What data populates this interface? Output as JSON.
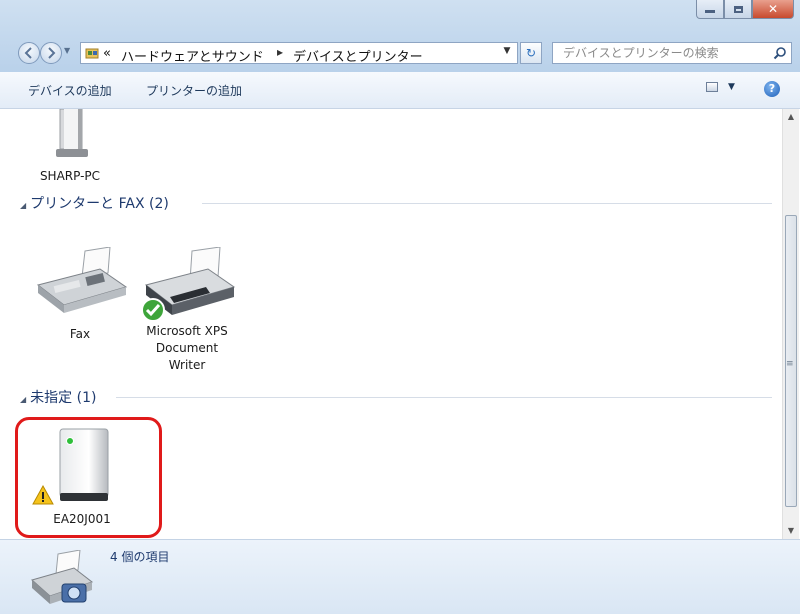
{
  "address": {
    "overflow": "«",
    "segments": [
      "ハードウェアとサウンド",
      "デバイスとプリンター"
    ]
  },
  "search": {
    "placeholder": "デバイスとプリンターの検索"
  },
  "toolbar": {
    "add_device": "デバイスの追加",
    "add_printer": "プリンターの追加"
  },
  "computer": {
    "name": "SHARP-PC"
  },
  "groups": {
    "printers": "プリンターと FAX (2)",
    "unspecified": "未指定 (1)"
  },
  "printers": {
    "fax": "Fax",
    "xps_line1": "Microsoft XPS",
    "xps_line2": "Document",
    "xps_line3": "Writer"
  },
  "unspecified_device": {
    "name": "EA20J001"
  },
  "status": {
    "item_count": "4 個の項目"
  },
  "colors": {
    "highlight": "#e01a1a",
    "chrome": "#b9d1ea"
  },
  "icons": [
    "minimize-icon",
    "maximize-icon",
    "close-icon",
    "back-icon",
    "forward-icon",
    "folder-icon",
    "refresh-icon",
    "search-icon",
    "view-icon",
    "help-icon",
    "computer-icon",
    "fax-icon",
    "printer-icon",
    "default-check-icon",
    "device-tower-icon",
    "warning-icon",
    "camera-printer-icon"
  ]
}
